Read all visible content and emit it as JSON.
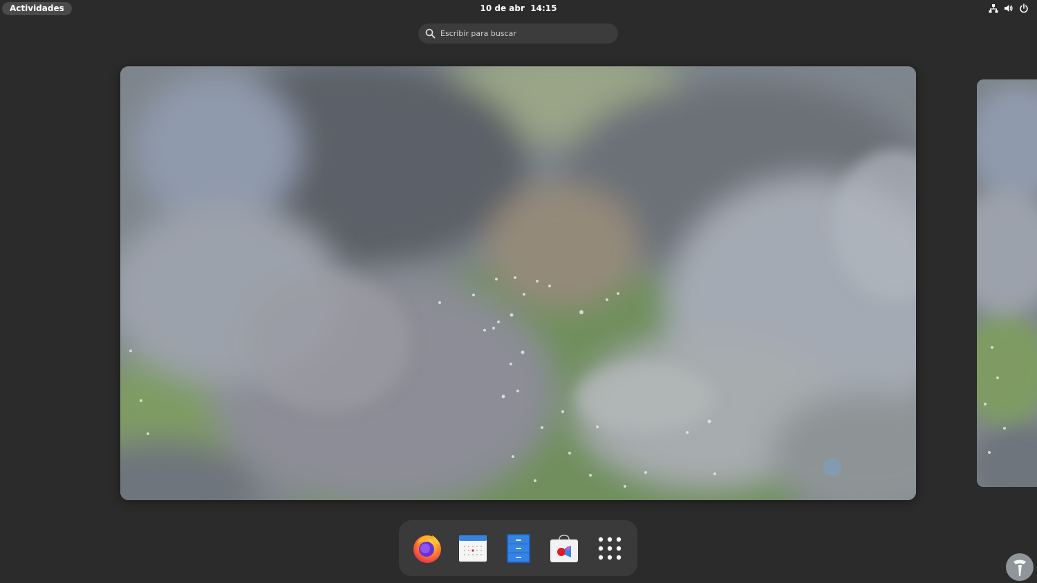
{
  "topbar": {
    "activities_label": "Actividades",
    "date": "10 de abr",
    "time": "14:15",
    "tray_icons": [
      "network-icon",
      "volume-icon",
      "power-icon"
    ]
  },
  "search": {
    "placeholder": "Escribir para buscar"
  },
  "dock": {
    "apps": [
      {
        "name": "firefox-icon"
      },
      {
        "name": "calendar-icon"
      },
      {
        "name": "files-icon"
      },
      {
        "name": "software-icon"
      },
      {
        "name": "app-grid-icon"
      }
    ]
  },
  "colors": {
    "panel_bg": "#2b2b2b",
    "dock_bg": "#3a3a3a",
    "search_bg": "#3c3c3c",
    "wallpaper_green": "#6f8f5c",
    "wallpaper_cloud": "#9aa0a8"
  }
}
